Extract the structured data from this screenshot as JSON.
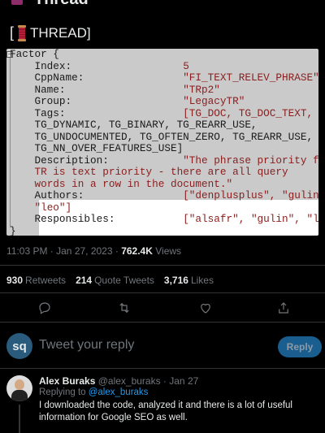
{
  "header": {
    "partial_title": "Thread"
  },
  "post": {
    "title_open": "[",
    "title_text": "THREAD]",
    "code_lines": [
      [
        "Factor {",
        ""
      ],
      [
        "    Index:                  ",
        "5"
      ],
      [
        "    CppName:                ",
        "\"FI_TEXT_RELEV_PHRASE\""
      ],
      [
        "    Name:                   ",
        "\"TRp2\""
      ],
      [
        "    Group:                  ",
        "\"LegacyTR\""
      ],
      [
        "    Tags:                   ",
        "[TG_DOC, TG_DOC_TEXT,"
      ],
      [
        "    TG_DYNAMIC, TG_BINARY, TG_REARR_USE,",
        ""
      ],
      [
        "    TG_UNDOCUMENTED, TG_OFTEN_ZERO, TG_REARR_USE,",
        ""
      ],
      [
        "    TG_NN_OVER_FEATURES_USE]",
        ""
      ],
      [
        "    Description:            ",
        "\"The phrase priority for"
      ],
      [
        "    ",
        "TR is text priority - there are all query"
      ],
      [
        "    ",
        "words in a row in the document.\""
      ],
      [
        "    Authors:                ",
        "[\"denplusplus\", \"gulin\","
      ],
      [
        "    ",
        "\"leo\"]"
      ],
      [
        "    Responsibles:           ",
        "[\"alsafr\", \"gulin\", \"leo\"]"
      ],
      [
        "}",
        ""
      ]
    ],
    "timestamp": "11:03 PM · Jan 27, 2023 · ",
    "views_count": "762.4K",
    "views_label": " Views"
  },
  "stats": {
    "retweets_count": "930",
    "retweets_label": "Retweets",
    "quotes_count": "214",
    "quotes_label": "Quote Tweets",
    "likes_count": "3,716",
    "likes_label": "Likes"
  },
  "reply_box": {
    "avatar_initials": "sq",
    "placeholder": "Tweet your reply",
    "button": "Reply"
  },
  "comment": {
    "name": "Alex Buraks",
    "handle_date": " @alex_buraks · Jan 27",
    "replying_prefix": "Replying to ",
    "replying_handle": "@alex_buraks",
    "text": "I downloaded the code, analyzed it and there is a lot of useful information for Google SEO as well."
  },
  "colors": {
    "accent": "#1d9bf0",
    "background": "#000000",
    "muted": "#71767b",
    "code_value": "#8b1d1d"
  },
  "icons": [
    "reply-icon",
    "retweet-icon",
    "like-icon",
    "share-icon"
  ]
}
